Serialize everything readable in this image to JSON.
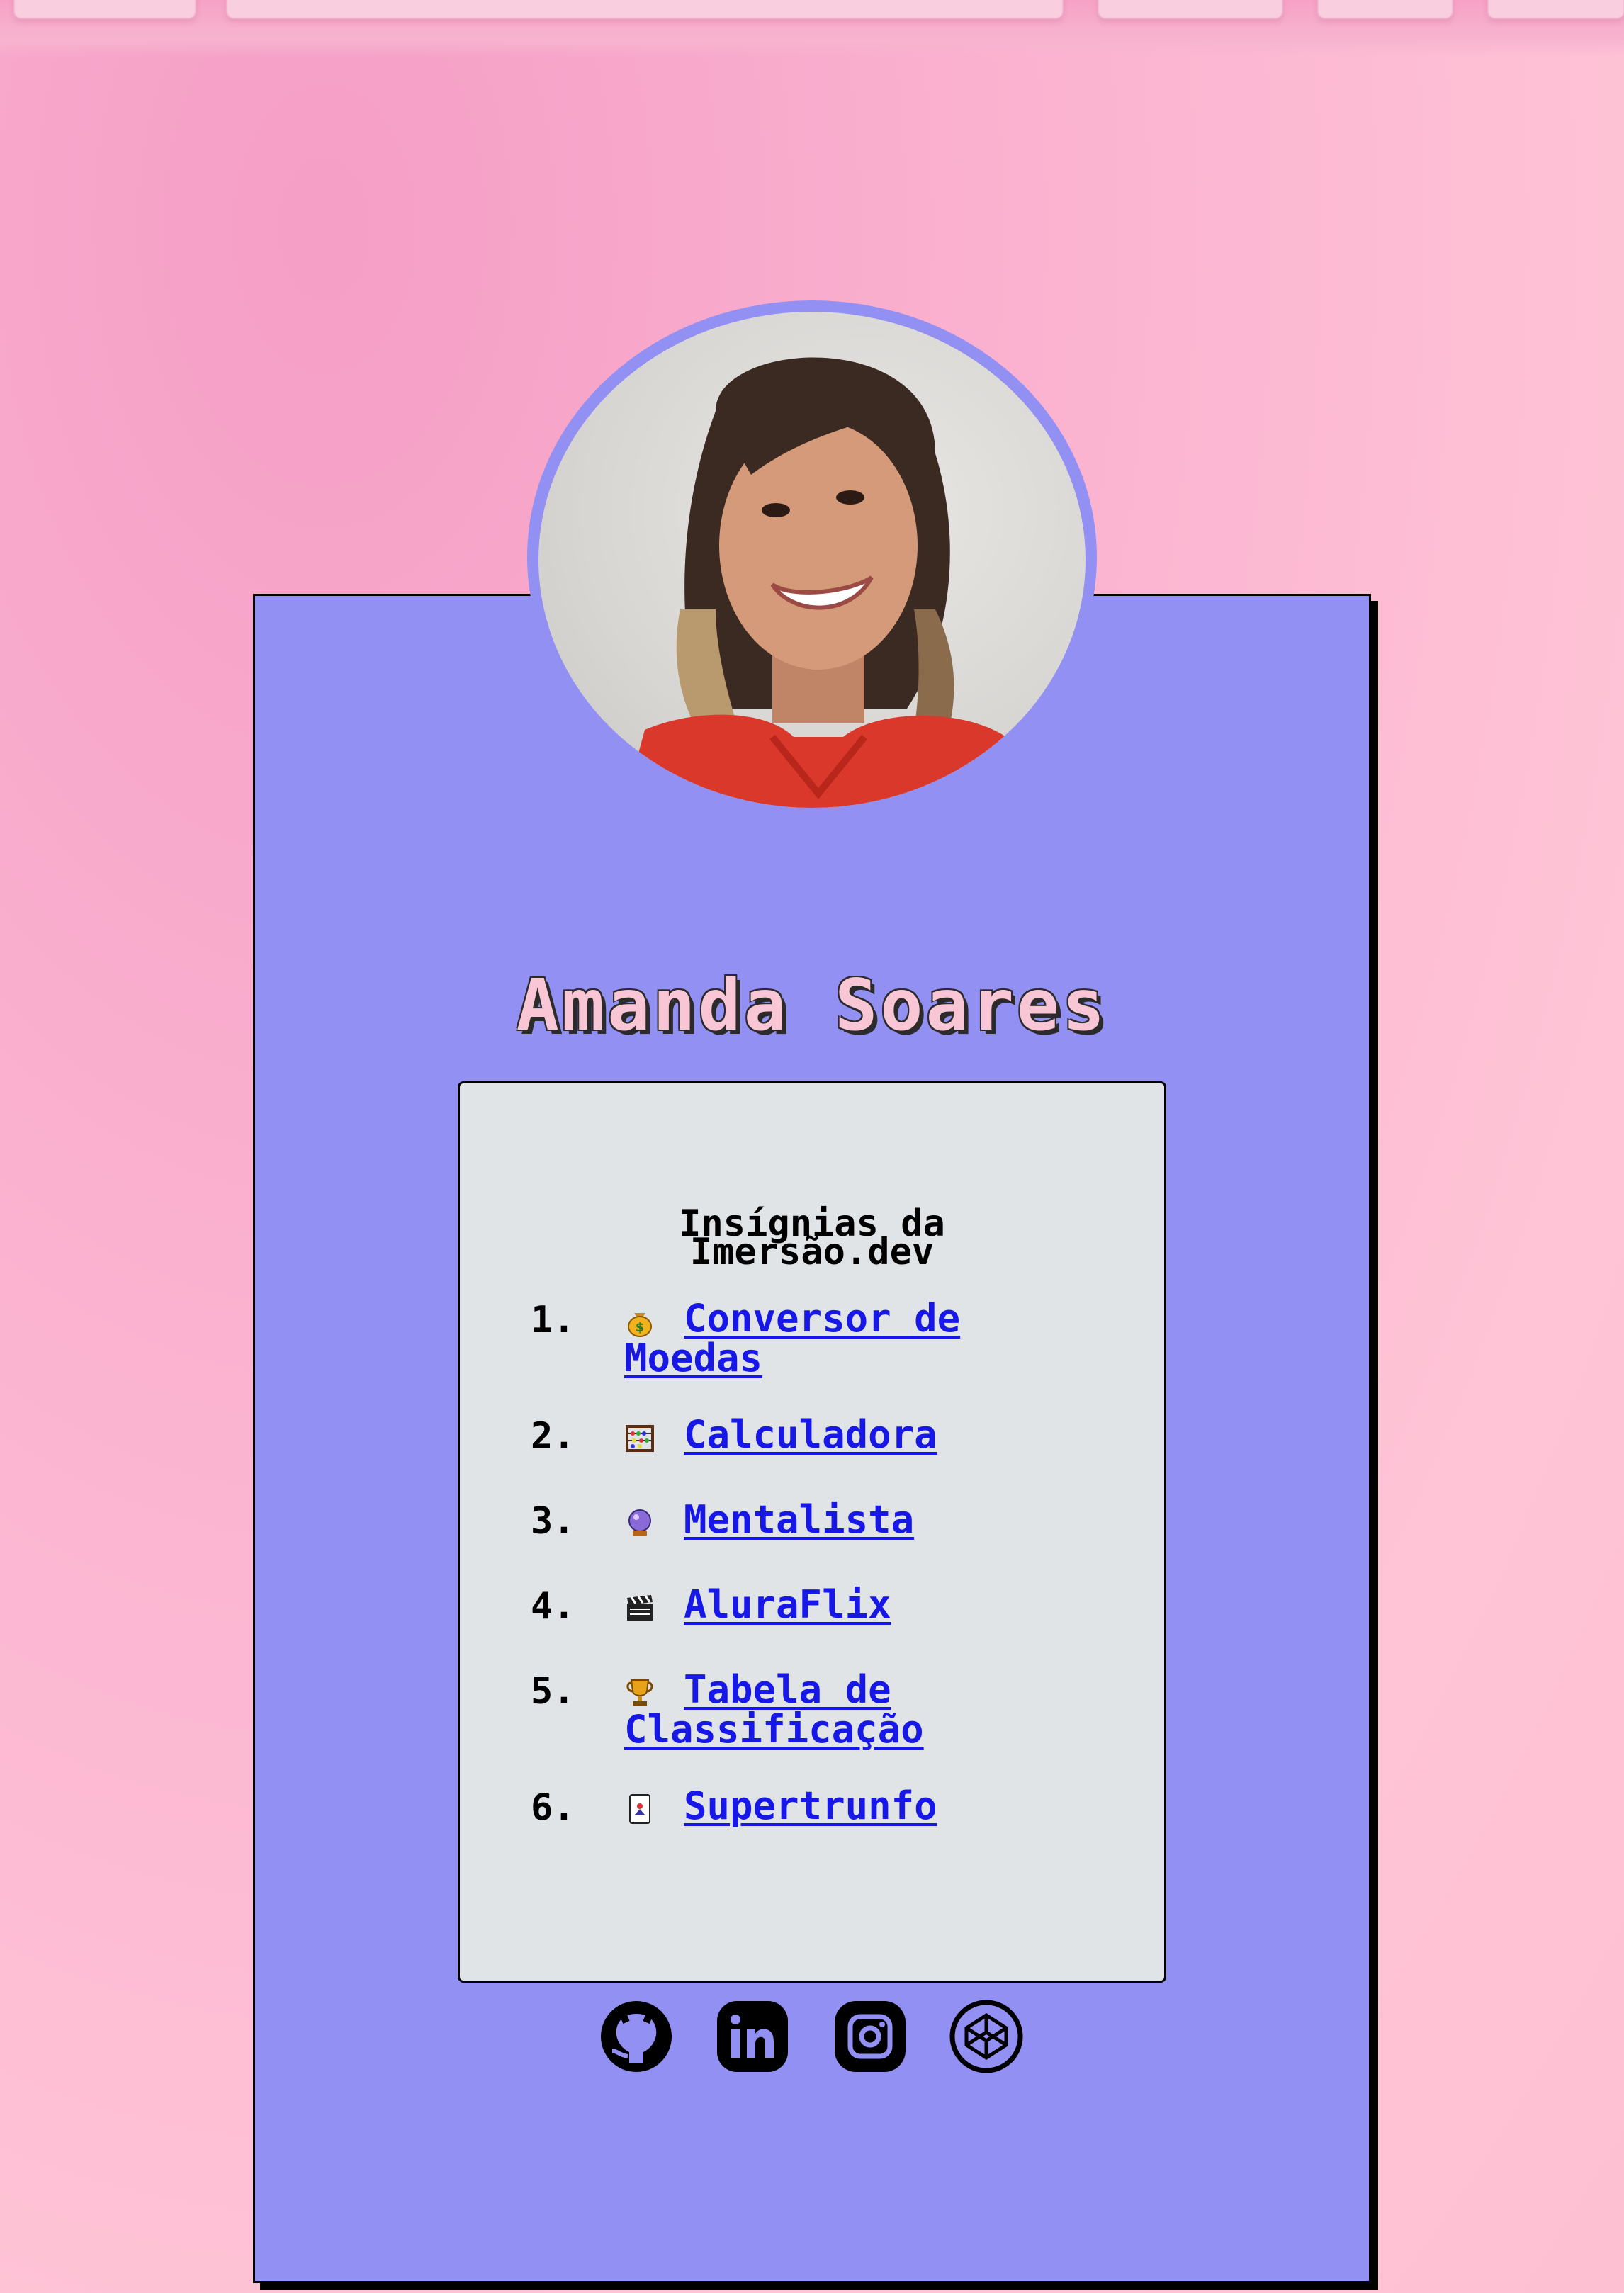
{
  "profile": {
    "name": "Amanda Soares",
    "avatar_icon": "profile-photo"
  },
  "badges": {
    "title": "Insígnias da Imersão.dev",
    "items": [
      {
        "number": "1.",
        "icon": "money-bag-icon",
        "label": "Conversor de Moedas"
      },
      {
        "number": "2.",
        "icon": "abacus-icon",
        "label": "Calculadora"
      },
      {
        "number": "3.",
        "icon": "crystal-ball-icon",
        "label": "Mentalista"
      },
      {
        "number": "4.",
        "icon": "clapper-board-icon",
        "label": "AluraFlix"
      },
      {
        "number": "5.",
        "icon": "trophy-icon",
        "label": "Tabela de Classificação"
      },
      {
        "number": "6.",
        "icon": "playing-card-icon",
        "label": "Supertrunfo"
      }
    ]
  },
  "socials": [
    {
      "icon": "github-icon"
    },
    {
      "icon": "linkedin-icon"
    },
    {
      "icon": "instagram-icon"
    },
    {
      "icon": "codepen-icon"
    }
  ],
  "colors": {
    "background": "#ffc4d6",
    "card": "#9390f3",
    "panel": "#e1e4e6",
    "link": "#1717e8",
    "name": "#f9c6d6"
  }
}
